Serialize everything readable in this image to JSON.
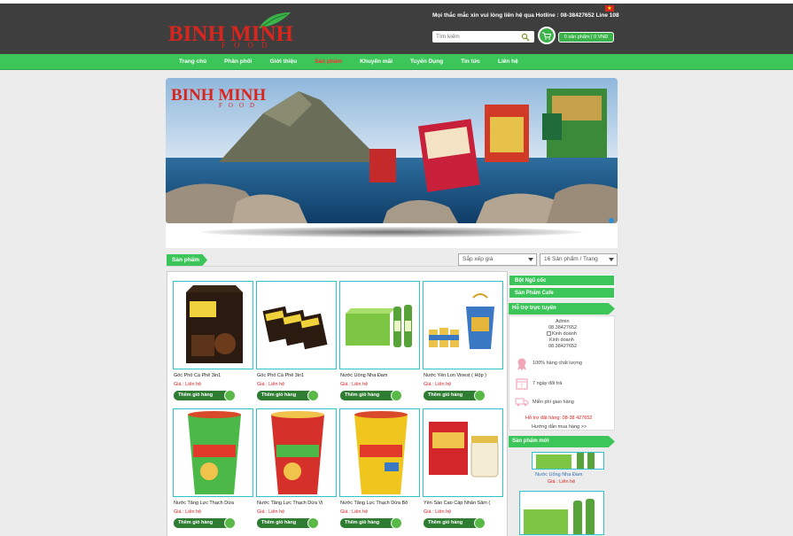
{
  "header": {
    "logo_word": "BINH MINH",
    "logo_sub": "FOOD",
    "hotline": "Mọi thắc mắc xin vui lòng liên hệ qua Hotline : 08-38427652 Line 108",
    "search_placeholder": "Tìm kiếm",
    "cart_count": "0",
    "cart_summary": "0 sản phẩm | 0 VNĐ"
  },
  "nav": {
    "items": [
      {
        "label": "Trang chủ"
      },
      {
        "label": "Phân phối"
      },
      {
        "label": "Giới thiệu"
      },
      {
        "label": "Sản phẩm"
      },
      {
        "label": "Khuyến mãi"
      },
      {
        "label": "Tuyển Dụng"
      },
      {
        "label": "Tin tức"
      },
      {
        "label": "Liên hệ"
      }
    ],
    "active_index": 3
  },
  "banner": {
    "logo_text": "BINH MINH",
    "logo_sub": "FOOD"
  },
  "products_section": {
    "title": "Sản phẩm",
    "sort_select": "Sắp xếp giá",
    "per_page_select": "16 Sản phẩm / Trang"
  },
  "products": [
    {
      "name": "Gốc Phố Cà Phê 3in1",
      "price": "Giá : Liên hệ",
      "button": "Thêm giỏ hàng"
    },
    {
      "name": "Gốc Phố Cà Phê 3in1",
      "price": "Giá : Liên hệ",
      "button": "Thêm giỏ hàng"
    },
    {
      "name": "Nước Uống Nha Đam",
      "price": "Giá : Liên hệ",
      "button": "Thêm giỏ hàng"
    },
    {
      "name": "Nước Yến Lon Vinest ( Hộp )",
      "price": "Giá : Liên hệ",
      "button": "Thêm giỏ hàng"
    },
    {
      "name": "Nước Tăng Lực Thạch Dừa",
      "price": "Giá : Liên hệ",
      "button": "Thêm giỏ hàng"
    },
    {
      "name": "Nước Tăng Lực Thạch Dừa Vị",
      "price": "Giá : Liên hệ",
      "button": "Thêm giỏ hàng"
    },
    {
      "name": "Nước Tăng Lực Thạch Dừa Bổ",
      "price": "Giá : Liên hệ",
      "button": "Thêm giỏ hàng"
    },
    {
      "name": "Yến Sào Cao Cấp Nhân Sâm (",
      "price": "Giá : Liên hệ",
      "button": "Thêm giỏ hàng"
    }
  ],
  "sidebar": {
    "categories": [
      {
        "label": "Bột Ngũ cốc"
      },
      {
        "label": "Sản Phẩm Cafe"
      }
    ],
    "support_title": "Hỗ trợ trực tuyến",
    "support": {
      "name1": "Admin",
      "phone1": "08.38427652",
      "img_alt": "Kinh doanh",
      "name2": "Kinh doanh",
      "phone2": "08.38427652"
    },
    "features": [
      {
        "text": "100% hàng chất lượng",
        "icon": "ribbon-icon"
      },
      {
        "text": "7 ngày đổi trả",
        "icon": "calendar-icon"
      },
      {
        "text": "Miễn phí giao hàng",
        "icon": "truck-icon"
      }
    ],
    "order_support": "Hỗ trợ đặt hàng: 08-38 427652",
    "howto": "Hướng dẫn mua hàng >>",
    "new_title": "Sản phẩm mới",
    "new_product_name": "Nước Uống Nha Đam",
    "new_product_price": "Giá : Liên hệ"
  },
  "colors": {
    "header_bg": "#3e3e3e",
    "nav_green": "#3cc65a",
    "brand_red": "#d8261f",
    "price_red": "#d52222",
    "button_green": "#2e7d32",
    "card_border": "#2ec3cf"
  }
}
